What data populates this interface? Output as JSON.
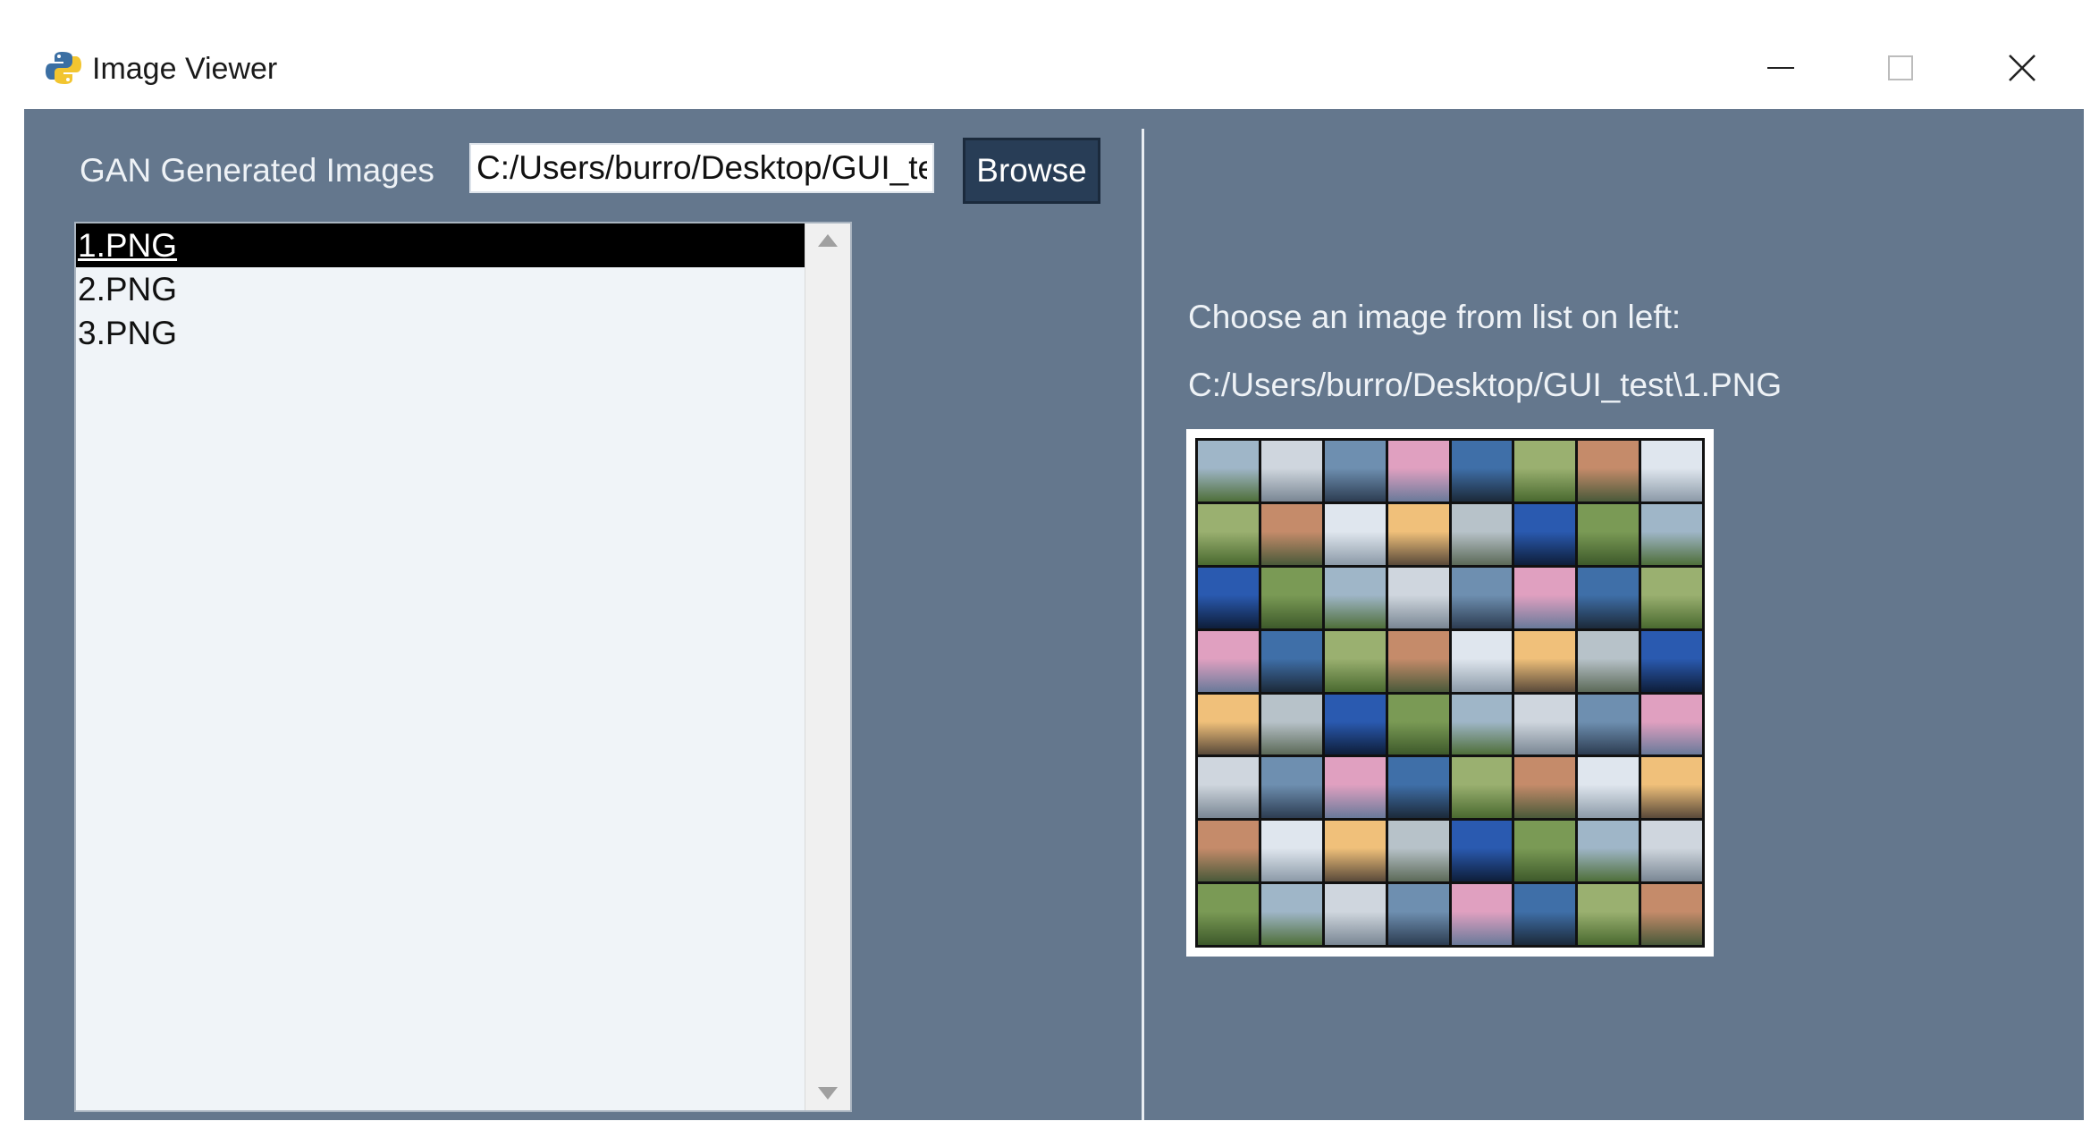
{
  "window": {
    "title": "Image Viewer"
  },
  "left_panel": {
    "folder_label": "GAN Generated Images",
    "folder_path_value": "C:/Users/burro/Desktop/GUI_te",
    "browse_label": "Browse",
    "files": [
      {
        "name": "1.PNG",
        "selected": true
      },
      {
        "name": "2.PNG",
        "selected": false
      },
      {
        "name": "3.PNG",
        "selected": false
      }
    ]
  },
  "right_panel": {
    "prompt": "Choose an image from list on left:",
    "selected_path": "C:/Users/burro/Desktop/GUI_test\\1.PNG"
  },
  "colors": {
    "panel_bg": "#64778d",
    "button_bg": "#283d56",
    "list_bg": "#f0f4f8",
    "selection_bg": "#000000",
    "label_text": "#eef2f6"
  },
  "icons": {
    "app": "python-logo-icon",
    "minimize": "minimize-icon",
    "maximize": "maximize-icon",
    "close": "close-icon",
    "scroll_up": "scroll-up-arrow-icon",
    "scroll_down": "scroll-down-arrow-icon"
  }
}
